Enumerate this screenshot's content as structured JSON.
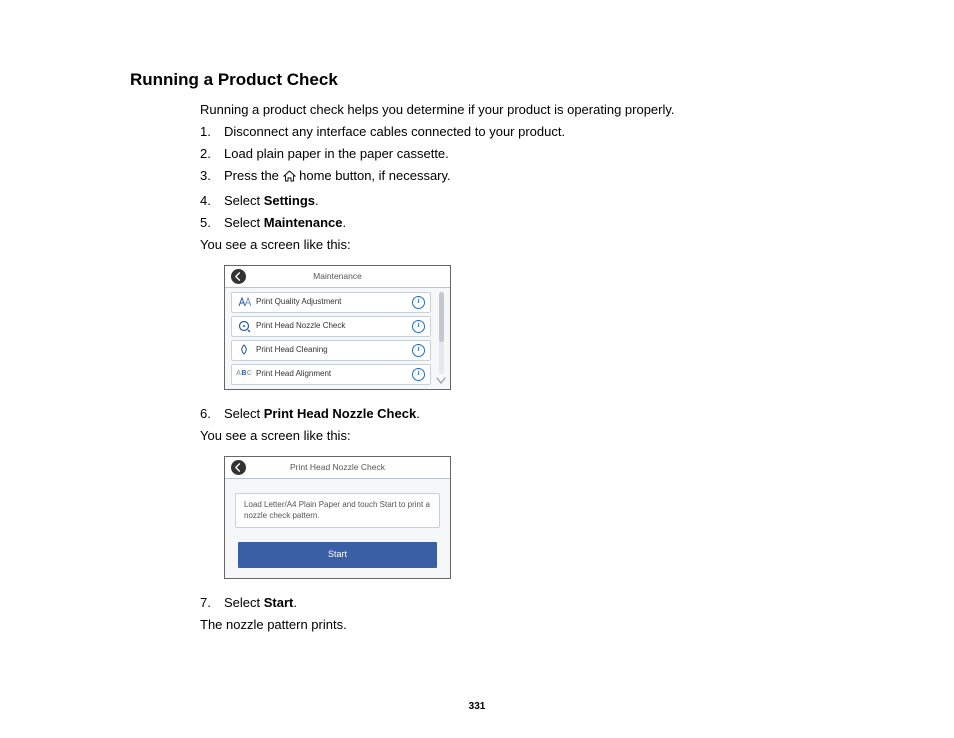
{
  "heading": "Running a Product Check",
  "intro": "Running a product check helps you determine if your product is operating properly.",
  "steps": {
    "s1": "Disconnect any interface cables connected to your product.",
    "s2": "Load plain paper in the paper cassette.",
    "s3_before": "Press the ",
    "s3_after": " home button, if necessary.",
    "s4_before": "Select ",
    "s4_bold": "Settings",
    "s4_after": ".",
    "s5_before": "Select ",
    "s5_bold": "Maintenance",
    "s5_after": ".",
    "s5_sub": "You see a screen like this:",
    "s6_before": "Select ",
    "s6_bold": "Print Head Nozzle Check",
    "s6_after": ".",
    "s6_sub": "You see a screen like this:",
    "s7_before": "Select ",
    "s7_bold": "Start",
    "s7_after": ".",
    "s7_sub": "The nozzle pattern prints."
  },
  "maintenance_screen": {
    "title": "Maintenance",
    "items": [
      {
        "label": "Print Quality Adjustment"
      },
      {
        "label": "Print Head Nozzle Check"
      },
      {
        "label": "Print Head Cleaning"
      },
      {
        "label": "Print Head Alignment"
      }
    ]
  },
  "nozzle_screen": {
    "title": "Print Head Nozzle Check",
    "message": "Load Letter/A4 Plain Paper and touch Start to print a nozzle check pattern.",
    "button": "Start"
  },
  "page_number": "331"
}
